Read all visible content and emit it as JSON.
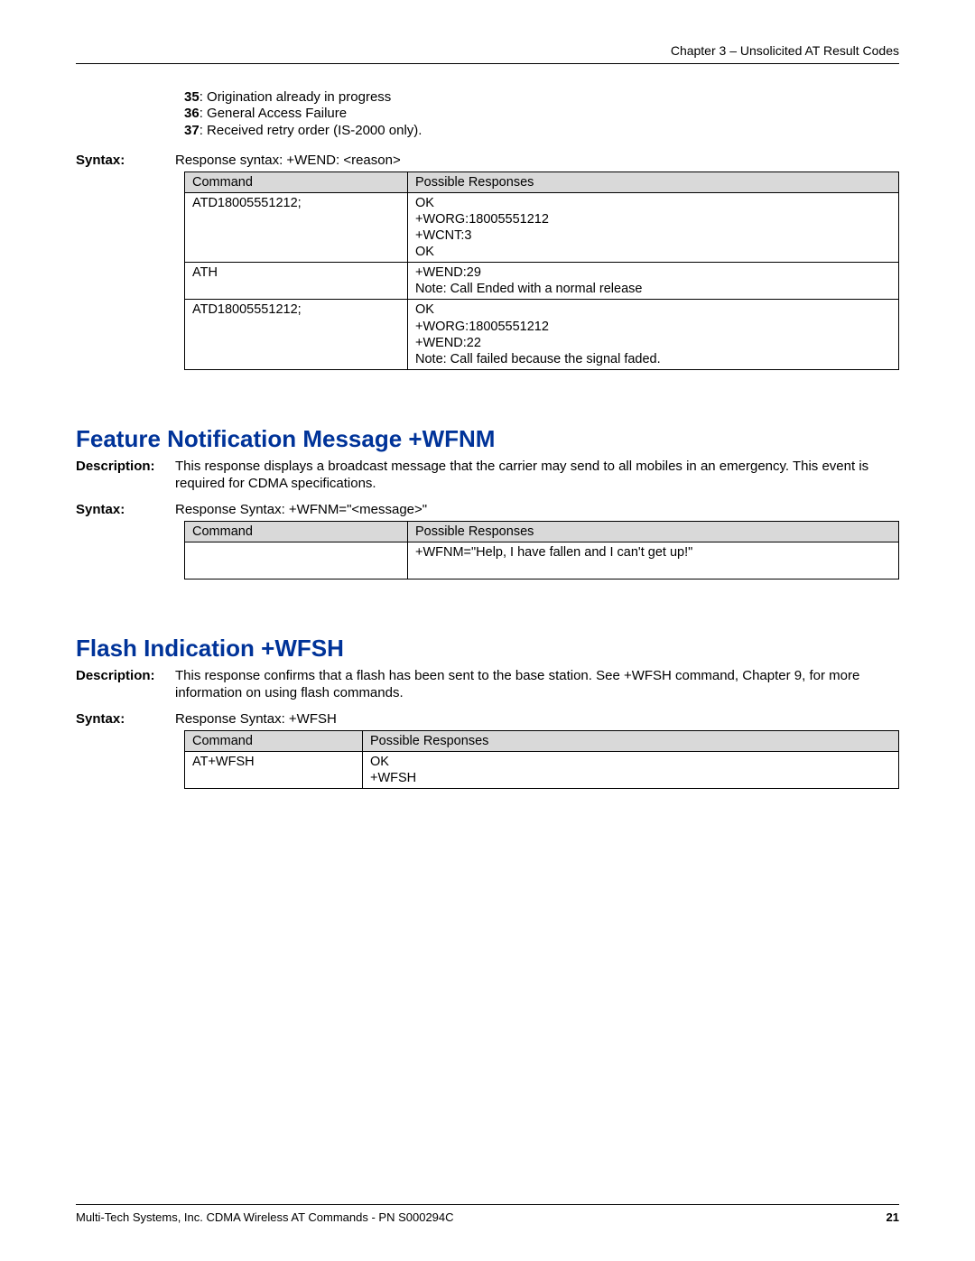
{
  "header": "Chapter 3 – Unsolicited AT Result Codes",
  "codes": [
    {
      "n": "35",
      "t": ": Origination already in progress"
    },
    {
      "n": "36",
      "t": ": General Access Failure"
    },
    {
      "n": "37",
      "t": ": Received retry order (IS-2000 only)."
    }
  ],
  "wend": {
    "syntax_label": "Syntax:",
    "syntax_text": "Response syntax: +WEND: <reason>",
    "headers": [
      "Command",
      "Possible Responses"
    ],
    "rows": [
      {
        "cmd": "ATD18005551212;",
        "resp": "OK\n+WORG:18005551212\n+WCNT:3\nOK"
      },
      {
        "cmd": "ATH",
        "resp": "+WEND:29\nNote: Call Ended with a normal release"
      },
      {
        "cmd": "ATD18005551212;",
        "resp": "OK\n+WORG:18005551212\n+WEND:22\nNote: Call failed because the signal faded."
      }
    ]
  },
  "wfnm": {
    "title": "Feature Notification Message  +WFNM",
    "desc_label": "Description:",
    "desc": "This response displays a broadcast message that the carrier may send to all mobiles in an emergency. This event is required for CDMA specifications.",
    "syntax_label": "Syntax:",
    "syntax_text": "Response Syntax: +WFNM=\"<message>\"",
    "headers": [
      "Command",
      "Possible Responses"
    ],
    "rows": [
      {
        "cmd": "",
        "resp": "+WFNM=\"Help, I have fallen and I can't get up!\""
      }
    ]
  },
  "wfsh": {
    "title": "Flash Indication  +WFSH",
    "desc_label": "Description:",
    "desc": "This response confirms that a flash has been sent to the base station. See +WFSH command, Chapter 9, for more information on using flash commands.",
    "syntax_label": "Syntax:",
    "syntax_text": "Response Syntax: +WFSH",
    "headers": [
      "Command",
      "Possible Responses"
    ],
    "rows": [
      {
        "cmd": "AT+WFSH",
        "resp": "OK\n+WFSH"
      }
    ]
  },
  "footer_left": "Multi-Tech Systems, Inc. CDMA Wireless AT Commands - PN S000294C",
  "footer_right": "21"
}
